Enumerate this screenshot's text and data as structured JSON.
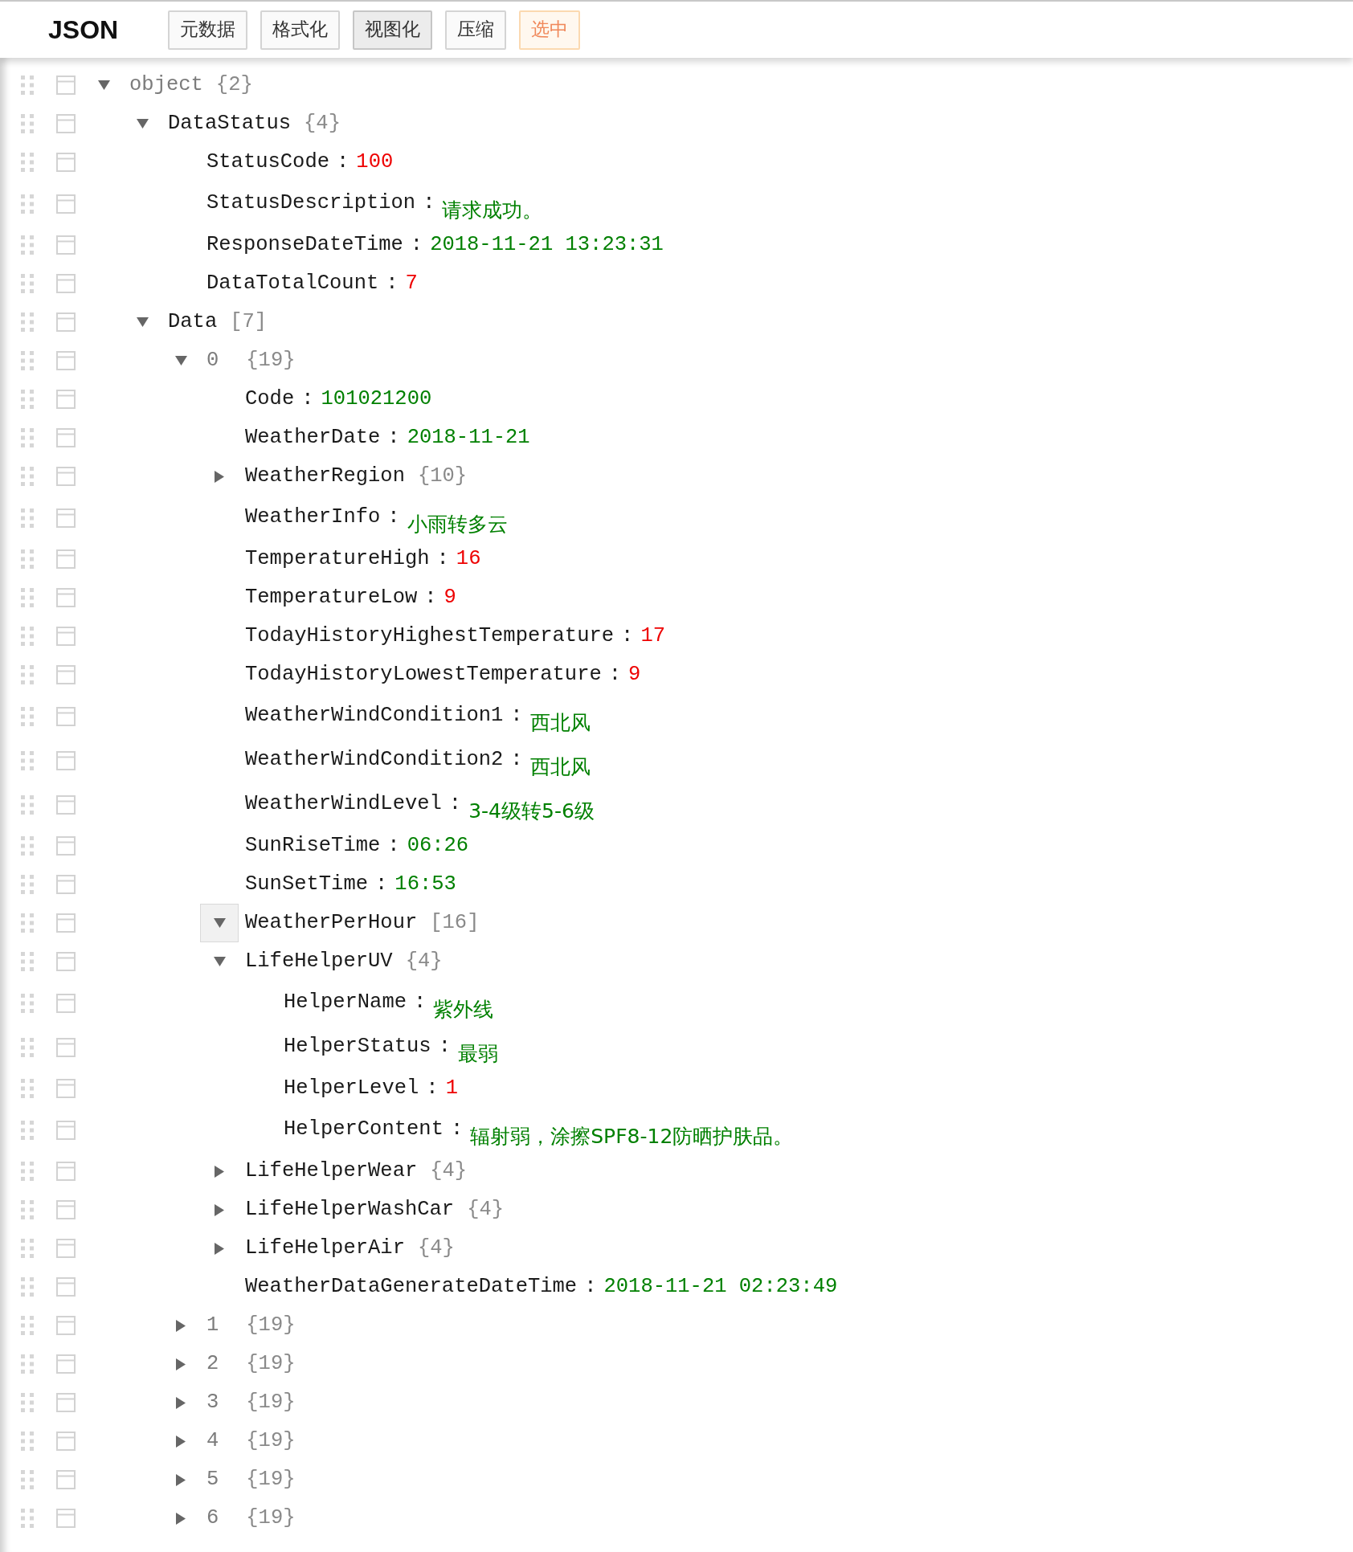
{
  "toolbar": {
    "title": "JSON",
    "buttons": [
      {
        "label": "元数据",
        "selected": false,
        "kind": "default"
      },
      {
        "label": "格式化",
        "selected": false,
        "kind": "default"
      },
      {
        "label": "视图化",
        "selected": true,
        "kind": "default"
      },
      {
        "label": "压缩",
        "selected": false,
        "kind": "default"
      },
      {
        "label": "选中",
        "selected": false,
        "kind": "highlight"
      }
    ]
  },
  "tree": {
    "key": {
      "text": "object",
      "kind": "root"
    },
    "kind": "container",
    "count": "{2}",
    "expanded": true,
    "hovered": false,
    "children": [
      {
        "key": {
          "text": "DataStatus",
          "kind": "name"
        },
        "kind": "container",
        "count": "{4}",
        "expanded": true,
        "hovered": false,
        "children": [
          {
            "key": {
              "text": "StatusCode",
              "kind": "name"
            },
            "separator": ":",
            "kind": "number",
            "value": "100"
          },
          {
            "key": {
              "text": "StatusDescription",
              "kind": "name"
            },
            "separator": ":",
            "kind": "string",
            "value": "请求成功。"
          },
          {
            "key": {
              "text": "ResponseDateTime",
              "kind": "name"
            },
            "separator": ":",
            "kind": "string",
            "value": "2018-11-21 13:23:31"
          },
          {
            "key": {
              "text": "DataTotalCount",
              "kind": "name"
            },
            "separator": ":",
            "kind": "number",
            "value": "7"
          }
        ]
      },
      {
        "key": {
          "text": "Data",
          "kind": "name"
        },
        "kind": "container",
        "count": "[7]",
        "expanded": true,
        "hovered": false,
        "children": [
          {
            "key": {
              "text": "0",
              "kind": "index"
            },
            "kind": "container",
            "count": "{19}",
            "expanded": true,
            "hovered": false,
            "children": [
              {
                "key": {
                  "text": "Code",
                  "kind": "name"
                },
                "separator": ":",
                "kind": "string",
                "value": "101021200"
              },
              {
                "key": {
                  "text": "WeatherDate",
                  "kind": "name"
                },
                "separator": ":",
                "kind": "string",
                "value": "2018-11-21"
              },
              {
                "key": {
                  "text": "WeatherRegion",
                  "kind": "name"
                },
                "kind": "container",
                "count": "{10}",
                "expanded": false,
                "hovered": false
              },
              {
                "key": {
                  "text": "WeatherInfo",
                  "kind": "name"
                },
                "separator": ":",
                "kind": "string",
                "value": "小雨转多云"
              },
              {
                "key": {
                  "text": "TemperatureHigh",
                  "kind": "name"
                },
                "separator": ":",
                "kind": "number",
                "value": "16"
              },
              {
                "key": {
                  "text": "TemperatureLow",
                  "kind": "name"
                },
                "separator": ":",
                "kind": "number",
                "value": "9"
              },
              {
                "key": {
                  "text": "TodayHistoryHighestTemperature",
                  "kind": "name"
                },
                "separator": ":",
                "kind": "number",
                "value": "17"
              },
              {
                "key": {
                  "text": "TodayHistoryLowestTemperature",
                  "kind": "name"
                },
                "separator": ":",
                "kind": "number",
                "value": "9"
              },
              {
                "key": {
                  "text": "WeatherWindCondition1",
                  "kind": "name"
                },
                "separator": ":",
                "kind": "string",
                "value": "西北风"
              },
              {
                "key": {
                  "text": "WeatherWindCondition2",
                  "kind": "name"
                },
                "separator": ":",
                "kind": "string",
                "value": "西北风"
              },
              {
                "key": {
                  "text": "WeatherWindLevel",
                  "kind": "name"
                },
                "separator": ":",
                "kind": "string",
                "value": "3-4级转5-6级"
              },
              {
                "key": {
                  "text": "SunRiseTime",
                  "kind": "name"
                },
                "separator": ":",
                "kind": "string",
                "value": "06:26"
              },
              {
                "key": {
                  "text": "SunSetTime",
                  "kind": "name"
                },
                "separator": ":",
                "kind": "string",
                "value": "16:53"
              },
              {
                "key": {
                  "text": "WeatherPerHour",
                  "kind": "name"
                },
                "kind": "container",
                "count": "[16]",
                "expanded": true,
                "hovered": true
              },
              {
                "key": {
                  "text": "LifeHelperUV",
                  "kind": "name"
                },
                "kind": "container",
                "count": "{4}",
                "expanded": true,
                "hovered": false,
                "children": [
                  {
                    "key": {
                      "text": "HelperName",
                      "kind": "name"
                    },
                    "separator": ":",
                    "kind": "string",
                    "value": "紫外线"
                  },
                  {
                    "key": {
                      "text": "HelperStatus",
                      "kind": "name"
                    },
                    "separator": ":",
                    "kind": "string",
                    "value": "最弱"
                  },
                  {
                    "key": {
                      "text": "HelperLevel",
                      "kind": "name"
                    },
                    "separator": ":",
                    "kind": "number",
                    "value": "1"
                  },
                  {
                    "key": {
                      "text": "HelperContent",
                      "kind": "name"
                    },
                    "separator": ":",
                    "kind": "string",
                    "value": "辐射弱，涂擦SPF8-12防晒护肤品。"
                  }
                ]
              },
              {
                "key": {
                  "text": "LifeHelperWear",
                  "kind": "name"
                },
                "kind": "container",
                "count": "{4}",
                "expanded": false,
                "hovered": false
              },
              {
                "key": {
                  "text": "LifeHelperWashCar",
                  "kind": "name"
                },
                "kind": "container",
                "count": "{4}",
                "expanded": false,
                "hovered": false
              },
              {
                "key": {
                  "text": "LifeHelperAir",
                  "kind": "name"
                },
                "kind": "container",
                "count": "{4}",
                "expanded": false,
                "hovered": false
              },
              {
                "key": {
                  "text": "WeatherDataGenerateDateTime",
                  "kind": "name"
                },
                "separator": ":",
                "kind": "string",
                "value": "2018-11-21 02:23:49"
              }
            ]
          },
          {
            "key": {
              "text": "1",
              "kind": "index"
            },
            "kind": "container",
            "count": "{19}",
            "expanded": false,
            "hovered": false
          },
          {
            "key": {
              "text": "2",
              "kind": "index"
            },
            "kind": "container",
            "count": "{19}",
            "expanded": false,
            "hovered": false
          },
          {
            "key": {
              "text": "3",
              "kind": "index"
            },
            "kind": "container",
            "count": "{19}",
            "expanded": false,
            "hovered": false
          },
          {
            "key": {
              "text": "4",
              "kind": "index"
            },
            "kind": "container",
            "count": "{19}",
            "expanded": false,
            "hovered": false
          },
          {
            "key": {
              "text": "5",
              "kind": "index"
            },
            "kind": "container",
            "count": "{19}",
            "expanded": false,
            "hovered": false
          },
          {
            "key": {
              "text": "6",
              "kind": "index"
            },
            "kind": "container",
            "count": "{19}",
            "expanded": false,
            "hovered": false
          }
        ]
      }
    ]
  }
}
